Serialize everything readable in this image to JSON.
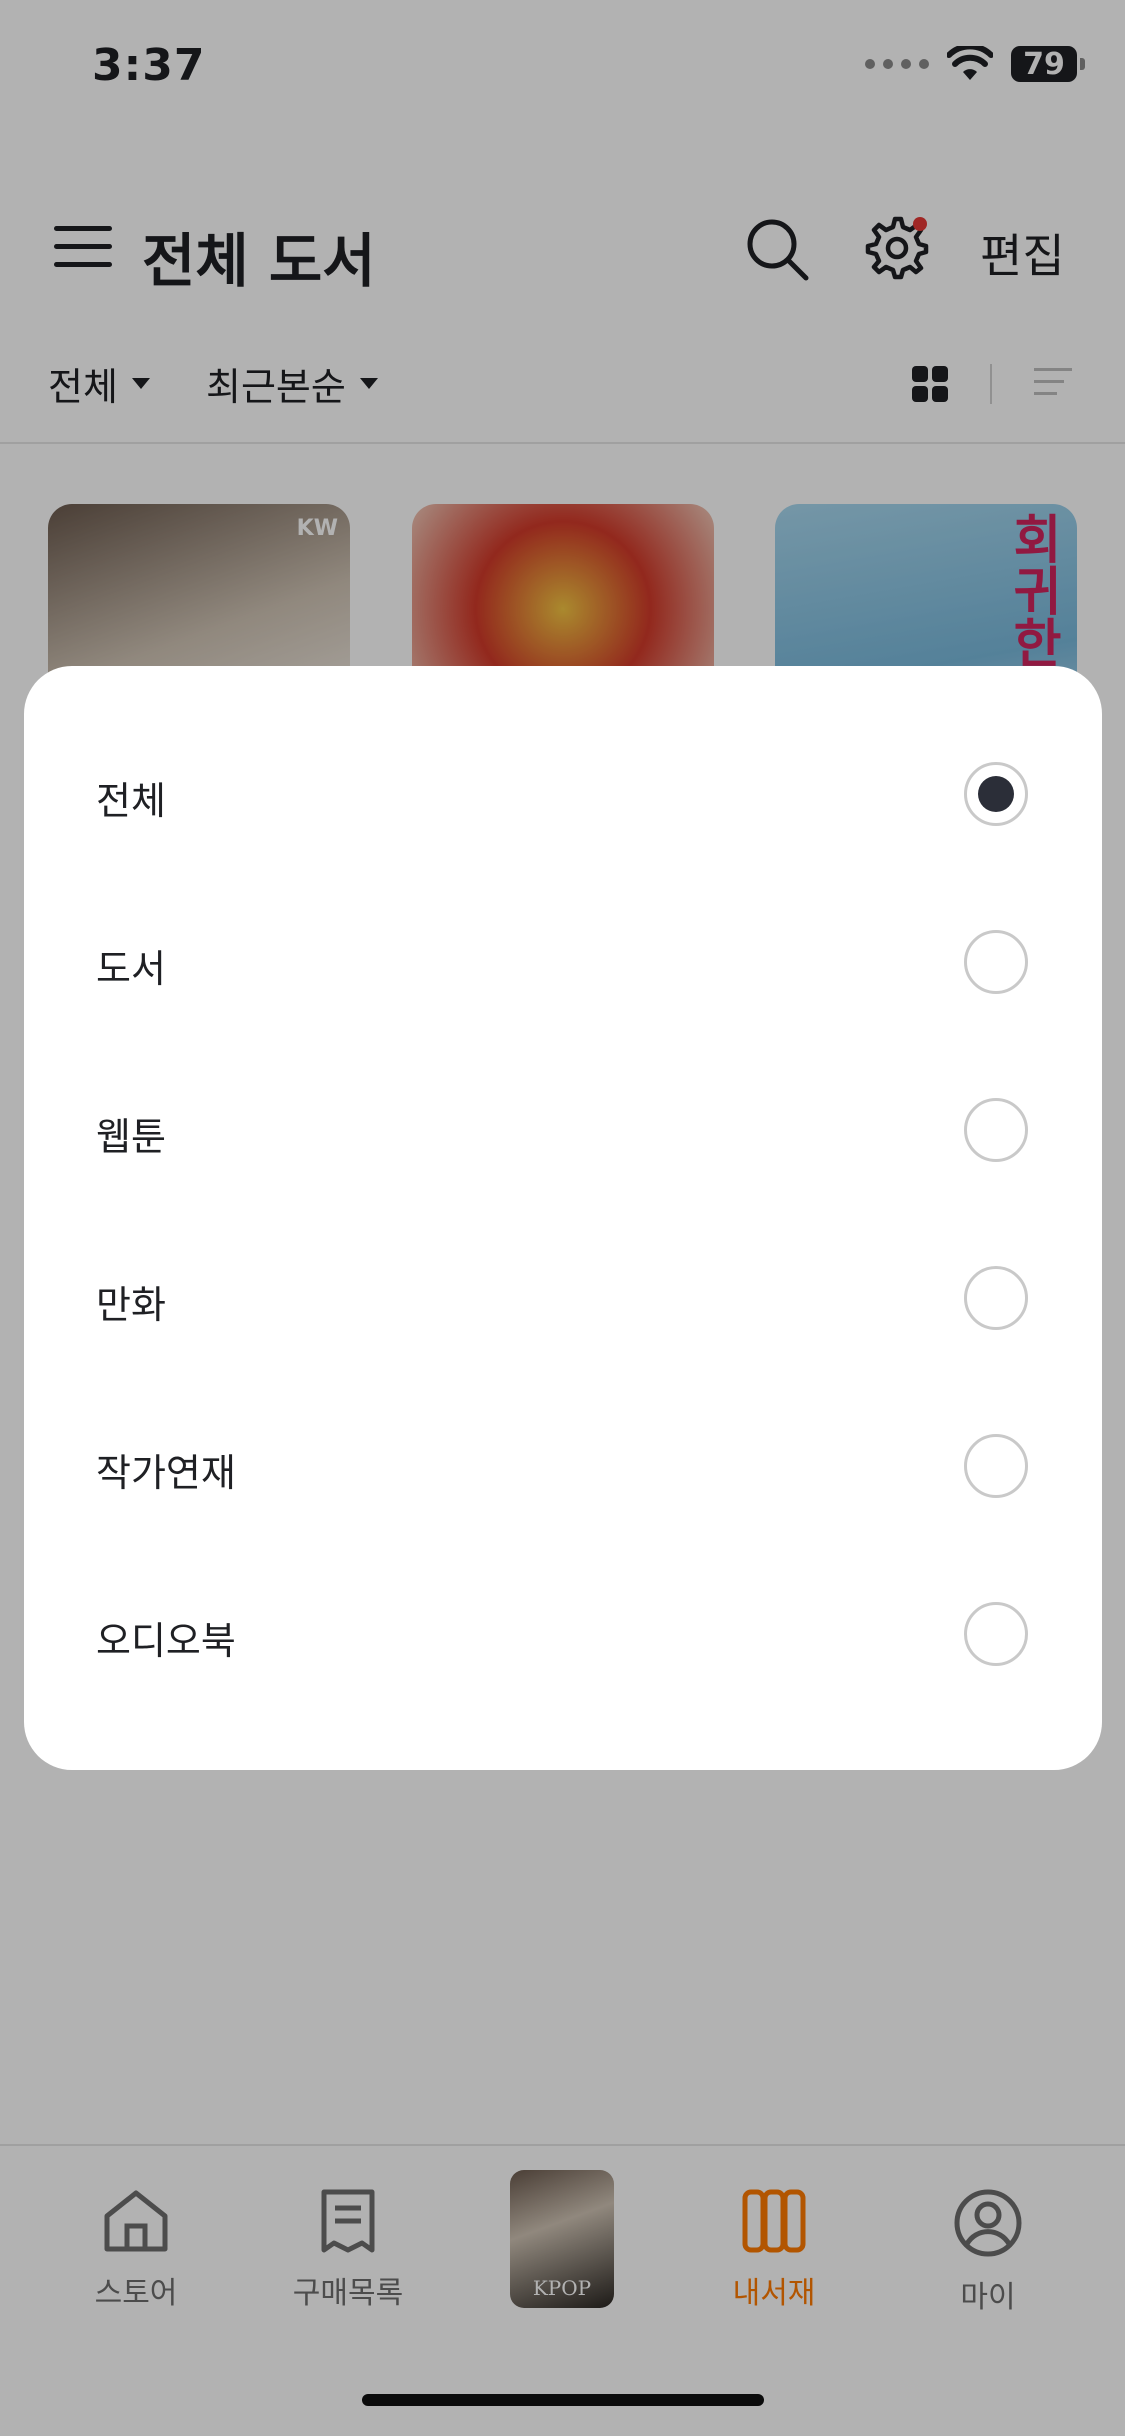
{
  "status_bar": {
    "time": "3:37",
    "battery": "79"
  },
  "header": {
    "title": "전체 도서",
    "edit_label": "편집"
  },
  "filters": {
    "type_label": "전체",
    "sort_label": "최근본순"
  },
  "books": [
    {
      "badge": "KW"
    },
    {
      "badge": ""
    },
    {
      "cover_text": "회귀한 인생"
    }
  ],
  "filter_sheet": {
    "options": [
      {
        "label": "전체",
        "selected": true
      },
      {
        "label": "도서",
        "selected": false
      },
      {
        "label": "웹툰",
        "selected": false
      },
      {
        "label": "만화",
        "selected": false
      },
      {
        "label": "작가연재",
        "selected": false
      },
      {
        "label": "오디오북",
        "selected": false
      }
    ]
  },
  "bottom_nav": {
    "items": [
      {
        "label": "스토어",
        "icon": "home-icon"
      },
      {
        "label": "구매목록",
        "icon": "receipt-icon"
      },
      {
        "label": "내서재",
        "icon": "library-icon",
        "active": true
      },
      {
        "label": "마이",
        "icon": "profile-icon"
      }
    ],
    "current_book_title": "KPOP"
  },
  "colors": {
    "accent": "#ff7a00",
    "notification_dot": "#e53935",
    "radio_selected": "#2b2e38"
  }
}
